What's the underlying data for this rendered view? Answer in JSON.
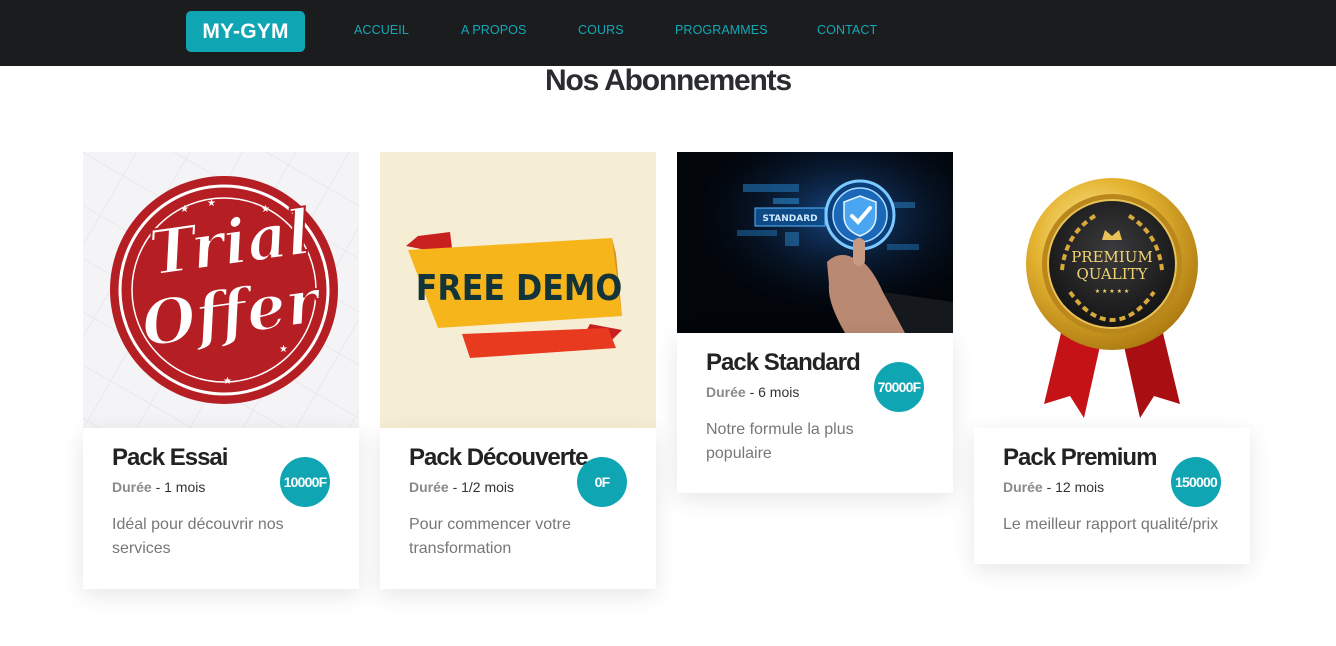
{
  "nav": {
    "brand": "MY-GYM",
    "links": [
      "ACCUEIL",
      "A PROPOS",
      "COURS",
      "PROGRAMMES",
      "CONTACT"
    ]
  },
  "section": {
    "title": "Nos Abonnements"
  },
  "cards": [
    {
      "title": "Pack Essai",
      "duration_label": "Durée",
      "duration_value": " - 1 mois",
      "price": "10000F",
      "description": "Idéal pour découvrir nos services",
      "image": "trial-offer-stamp-image",
      "image_text": "Trial Offer"
    },
    {
      "title": "Pack Découverte",
      "duration_label": "Durée",
      "duration_value": " - 1/2 mois",
      "price": "0F",
      "description": "Pour commencer votre transformation",
      "image": "free-demo-banner-image",
      "image_text": "FREE DEMO"
    },
    {
      "title": "Pack Standard",
      "duration_label": "Durée",
      "duration_value": " - 6 mois",
      "price": "70000F",
      "description": "Notre formule la plus populaire",
      "image": "standard-shield-image",
      "image_text": "STANDARD"
    },
    {
      "title": "Pack Premium",
      "duration_label": "Durée",
      "duration_value": " - 12 mois",
      "price": "150000",
      "description": "Le meilleur rapport qualité/prix",
      "image": "premium-quality-medal-image",
      "image_text": "PREMIUM QUALITY"
    }
  ],
  "colors": {
    "accent": "#10a5b3",
    "navbar": "#1b1c1e",
    "title": "#2a2c30"
  }
}
